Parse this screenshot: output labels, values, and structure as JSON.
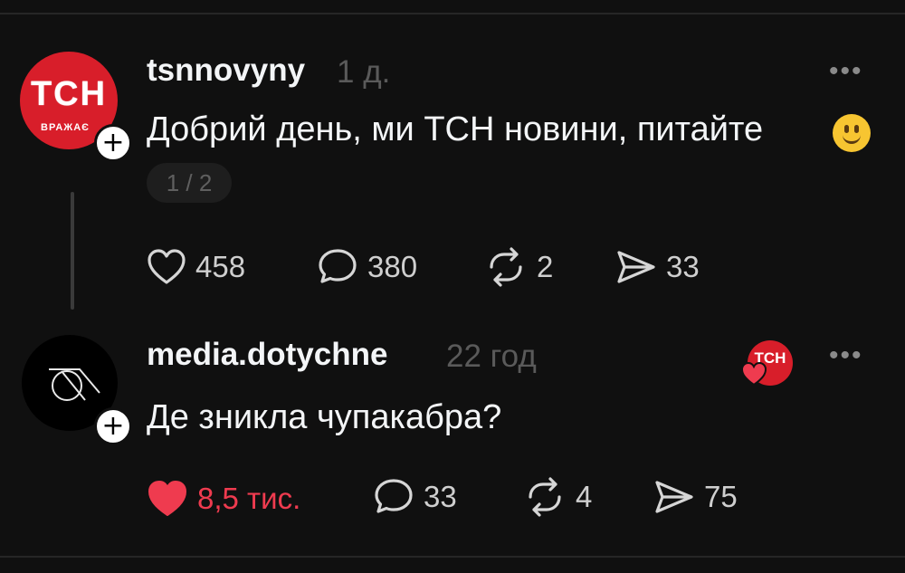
{
  "posts": [
    {
      "username": "tsnnovyny",
      "time": "1 д.",
      "text": "Добрий день, ми ТСН новини, питайте",
      "emoji_icon": "slightly-smiling-face-emoji",
      "pager": "1 / 2",
      "avatar_logo": "ТСН",
      "avatar_sub": "ВРАЖАЄ",
      "likes": "458",
      "comments": "380",
      "reposts": "2",
      "shares": "33",
      "liked": false
    },
    {
      "username": "media.dotychne",
      "time": "22 год",
      "text": "Де зникла чупакабра?",
      "likes": "8,5 тис.",
      "comments": "33",
      "reposts": "4",
      "shares": "75",
      "liked": true,
      "liked_by_logo": "ТСН"
    }
  ],
  "more_label": "•••",
  "colors": {
    "background": "#101010",
    "text": "#f3f5f7",
    "muted": "#5a5a5a",
    "like_red": "#ef3b4f",
    "tsn_red": "#d81e2a"
  }
}
